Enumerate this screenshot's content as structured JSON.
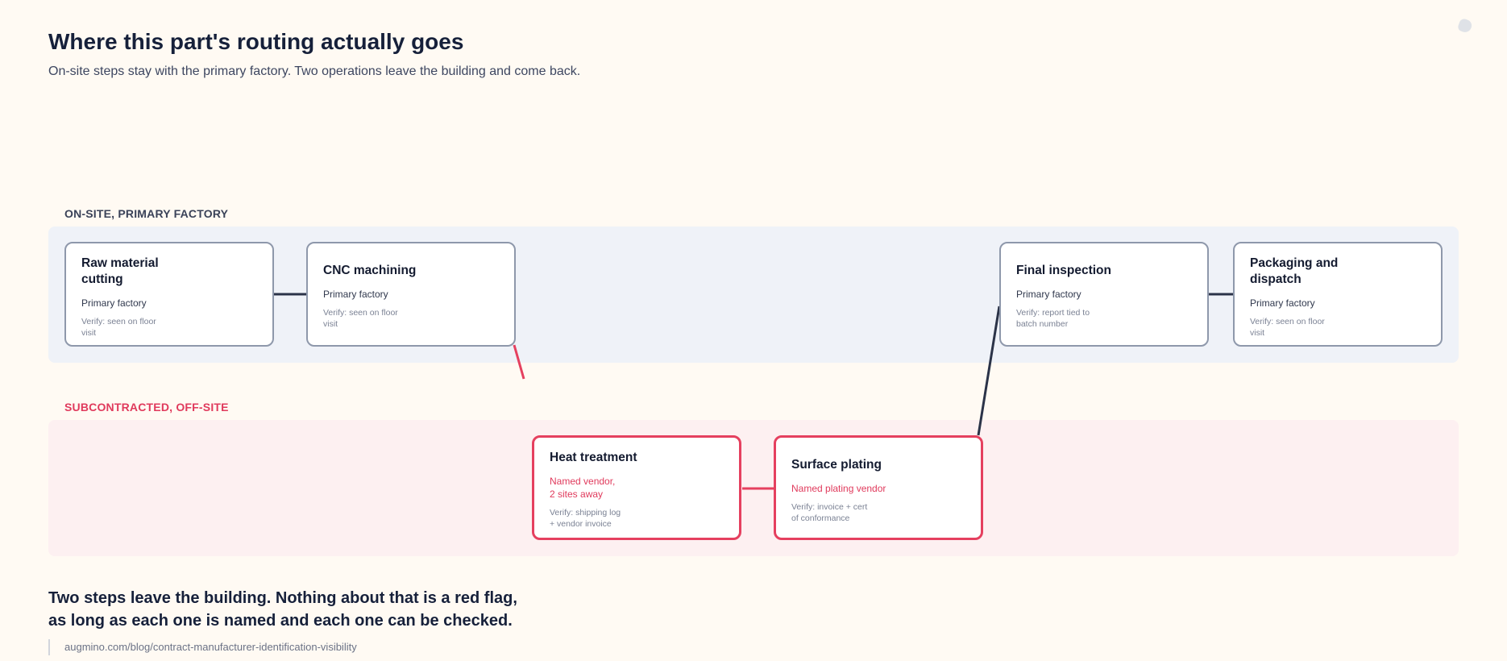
{
  "header": {
    "title": "Where this part's routing actually goes",
    "subtitle": "On-site steps stay with the primary factory. Two operations leave the building and come back."
  },
  "zones": {
    "onsite_label": "ON-SITE, PRIMARY FACTORY",
    "offsite_label": "SUBCONTRACTED, OFF-SITE"
  },
  "steps": [
    {
      "title": "Raw material\ncutting",
      "location": "Primary factory",
      "verify": "Verify: seen on floor\nvisit",
      "zone": "onsite"
    },
    {
      "title": "CNC machining",
      "location": "Primary factory",
      "verify": "Verify: seen on floor\nvisit",
      "zone": "onsite"
    },
    {
      "title": "Heat treatment",
      "location": "Named vendor,\n2 sites away",
      "verify": "Verify: shipping log\n+ vendor invoice",
      "zone": "offsite"
    },
    {
      "title": "Surface plating",
      "location": "Named plating vendor",
      "verify": "Verify: invoice + cert\nof conformance",
      "zone": "offsite"
    },
    {
      "title": "Final inspection",
      "location": "Primary factory",
      "verify": "Verify: report tied to\nbatch number",
      "zone": "onsite"
    },
    {
      "title": "Packaging and\ndispatch",
      "location": "Primary factory",
      "verify": "Verify: seen on floor\nvisit",
      "zone": "onsite"
    }
  ],
  "colors": {
    "onsite_border": "#8e98ab",
    "offsite_accent": "#e5405f",
    "connector_dark": "#2b3348",
    "background": "#fffaf3"
  },
  "footer": {
    "takeaway": "Two steps leave the building. Nothing about that is a red flag,\nas long as each one is named and each one can be checked.",
    "source": "augmino.com/blog/contract-manufacturer-identification-visibility"
  }
}
